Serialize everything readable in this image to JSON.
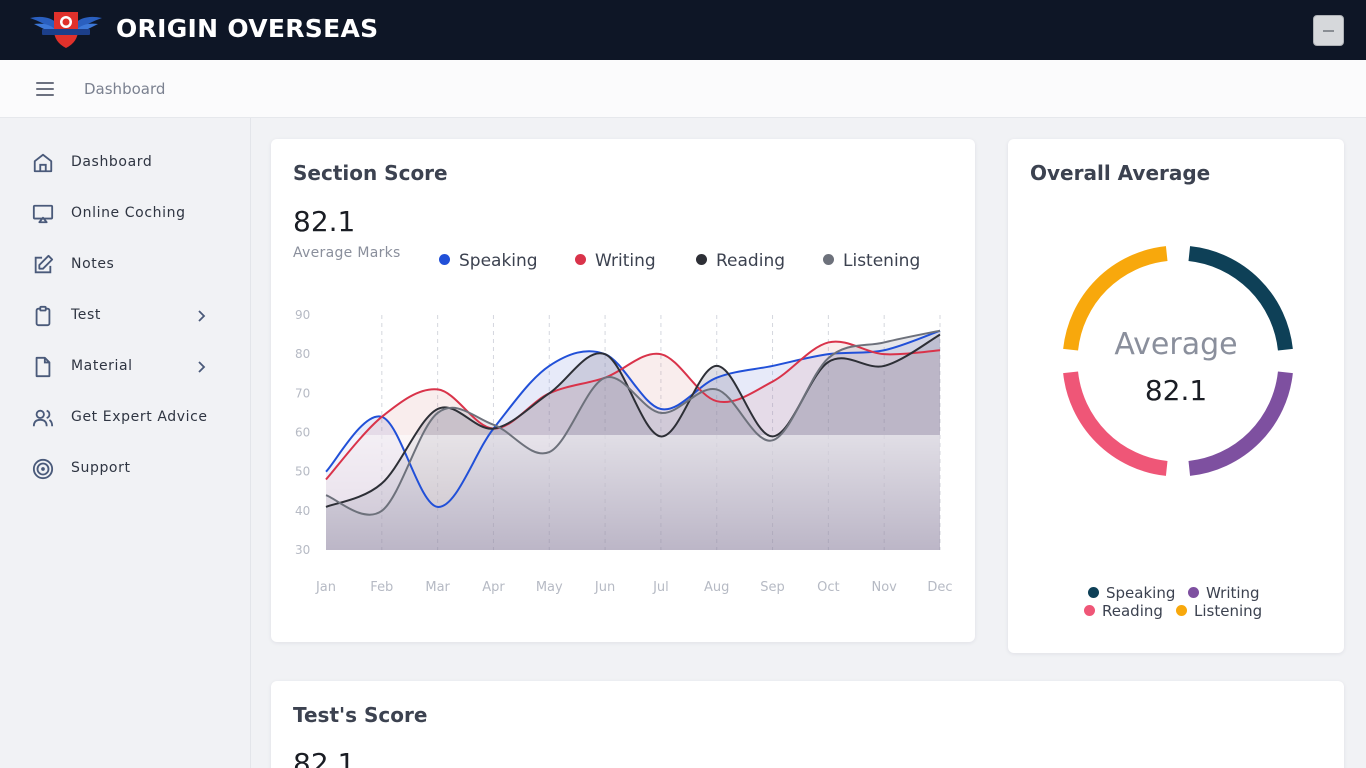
{
  "app": {
    "brand": "ORIGIN OVERSEAS"
  },
  "header": {
    "breadcrumb": "Dashboard"
  },
  "sidebar": {
    "items": [
      {
        "label": "Dashboard",
        "icon": "home-icon"
      },
      {
        "label": "Online Coching",
        "icon": "monitor-icon"
      },
      {
        "label": "Notes",
        "icon": "edit-icon"
      },
      {
        "label": "Test",
        "icon": "clipboard-icon",
        "has_submenu": true
      },
      {
        "label": "Material",
        "icon": "file-icon",
        "has_submenu": true
      },
      {
        "label": "Get Expert Advice",
        "icon": "users-icon"
      },
      {
        "label": "Support",
        "icon": "target-icon"
      }
    ]
  },
  "section_score": {
    "title": "Section Score",
    "value": "82.1",
    "label": "Average Marks",
    "legend": [
      {
        "name": "Speaking",
        "color": "#2150d8"
      },
      {
        "name": "Writing",
        "color": "#d9334a"
      },
      {
        "name": "Reading",
        "color": "#2d2f36"
      },
      {
        "name": "Listening",
        "color": "#6d717b"
      }
    ]
  },
  "overall_average": {
    "title": "Overall Average",
    "center_label": "Average",
    "center_value": "82.1",
    "legend": [
      {
        "name": "Speaking",
        "color": "#0e4057"
      },
      {
        "name": "Writing",
        "color": "#7e50a0"
      },
      {
        "name": "Reading",
        "color": "#ef5677"
      },
      {
        "name": "Listening",
        "color": "#f8a80c"
      }
    ]
  },
  "tests_score": {
    "title": "Test's Score",
    "value": "82.1"
  },
  "chart_data": [
    {
      "type": "area",
      "categories": [
        "Jan",
        "Feb",
        "Mar",
        "Apr",
        "May",
        "Jun",
        "Jul",
        "Aug",
        "Sep",
        "Oct",
        "Nov",
        "Dec"
      ],
      "ylim": [
        30,
        90
      ],
      "yticks": [
        30,
        40,
        50,
        60,
        70,
        80,
        90
      ],
      "series": [
        {
          "name": "Speaking",
          "color": "#2150d8",
          "values": [
            50,
            64,
            41,
            61,
            77,
            80,
            66,
            74,
            77,
            80,
            81,
            86
          ]
        },
        {
          "name": "Writing",
          "color": "#d9334a",
          "values": [
            48,
            64,
            71,
            61,
            70,
            74,
            80,
            68,
            73,
            83,
            80,
            81
          ]
        },
        {
          "name": "Reading",
          "color": "#2d2f36",
          "values": [
            41,
            47,
            66,
            61,
            70,
            80,
            59,
            77,
            59,
            78,
            77,
            85
          ]
        },
        {
          "name": "Listening",
          "color": "#6d717b",
          "values": [
            44,
            40,
            65,
            62,
            55,
            74,
            65,
            71,
            58,
            79,
            83,
            86
          ]
        }
      ]
    },
    {
      "type": "pie",
      "categories": [
        "Speaking",
        "Writing",
        "Reading",
        "Listening"
      ],
      "values": [
        25,
        25,
        25,
        25
      ]
    }
  ]
}
